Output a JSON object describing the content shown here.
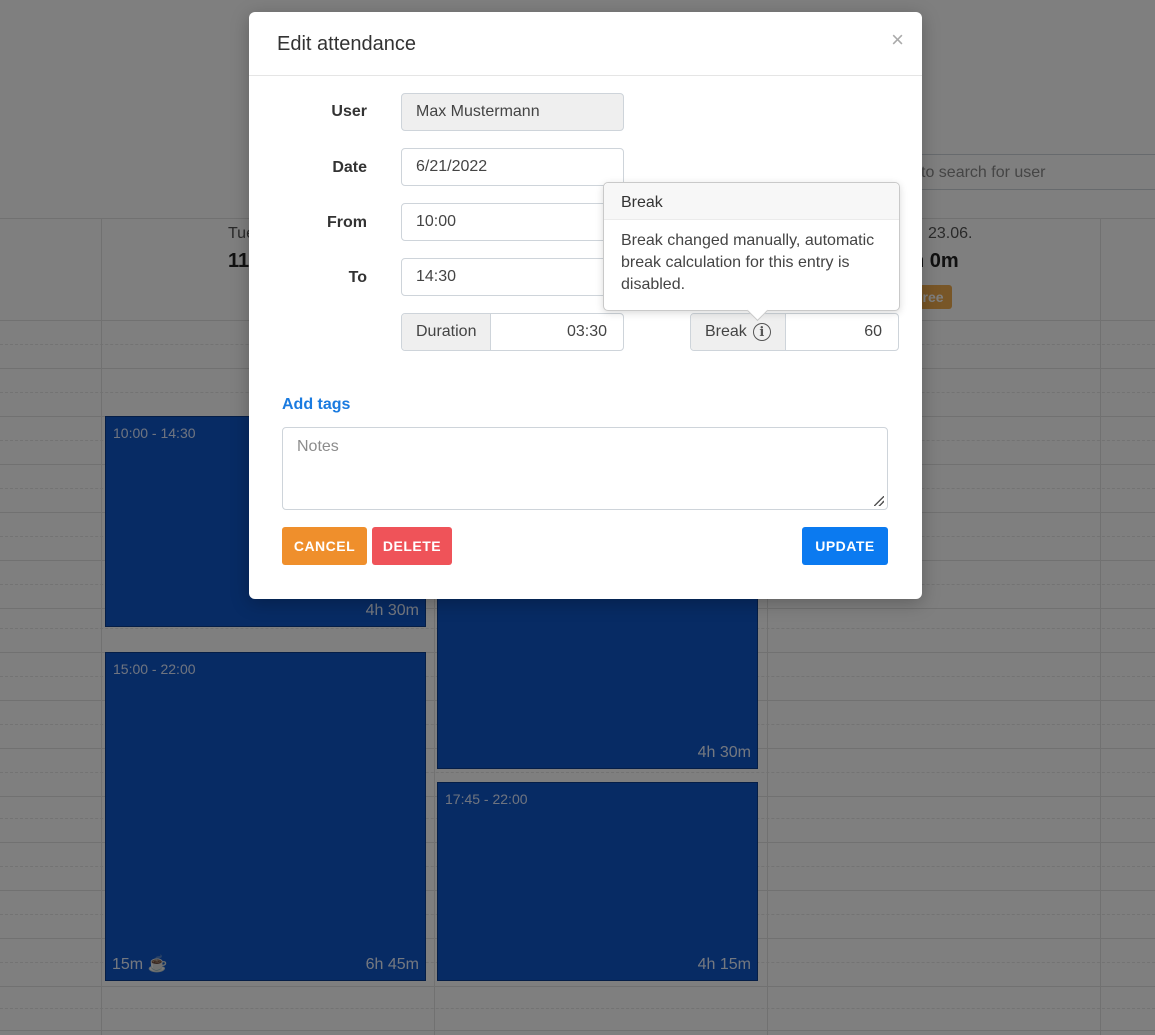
{
  "background": {
    "search_placeholder": "to search for user",
    "day_headers": [
      "Tue",
      "23.06."
    ],
    "day_totals": [
      "11",
      "h 0m"
    ],
    "day_badge": "Free",
    "shifts": [
      {
        "time": "10:00 - 14:30",
        "duration": "4h 30m"
      },
      {
        "time": "",
        "duration": "4h 30m"
      },
      {
        "time": "15:00 - 22:00",
        "duration": "6h 45m",
        "break": "15m"
      },
      {
        "time": "17:45 - 22:00",
        "duration": "4h 15m"
      }
    ]
  },
  "modal": {
    "title": "Edit attendance",
    "close_symbol": "×",
    "user_label": "User",
    "user_value": "Max Mustermann",
    "date_label": "Date",
    "date_value": "6/21/2022",
    "from_label": "From",
    "from_value": "10:00",
    "to_label": "To",
    "to_value": "14:30",
    "duration_label": "Duration",
    "duration_value": "03:30",
    "break_label": "Break",
    "break_value": "60",
    "add_tags_label": "Add tags",
    "notes_placeholder": "Notes",
    "cancel_label": "CANCEL",
    "delete_label": "DELETE",
    "update_label": "UPDATE"
  },
  "popover": {
    "title": "Break",
    "body": "Break changed manually, automatic break calculation for this entry is disabled."
  },
  "colors": {
    "shift_blue": "#0f56c9",
    "cancel_orange": "#ef8f2c",
    "delete_red": "#ef5359",
    "update_blue": "#0b7af0",
    "link_blue": "#1a7be0"
  }
}
